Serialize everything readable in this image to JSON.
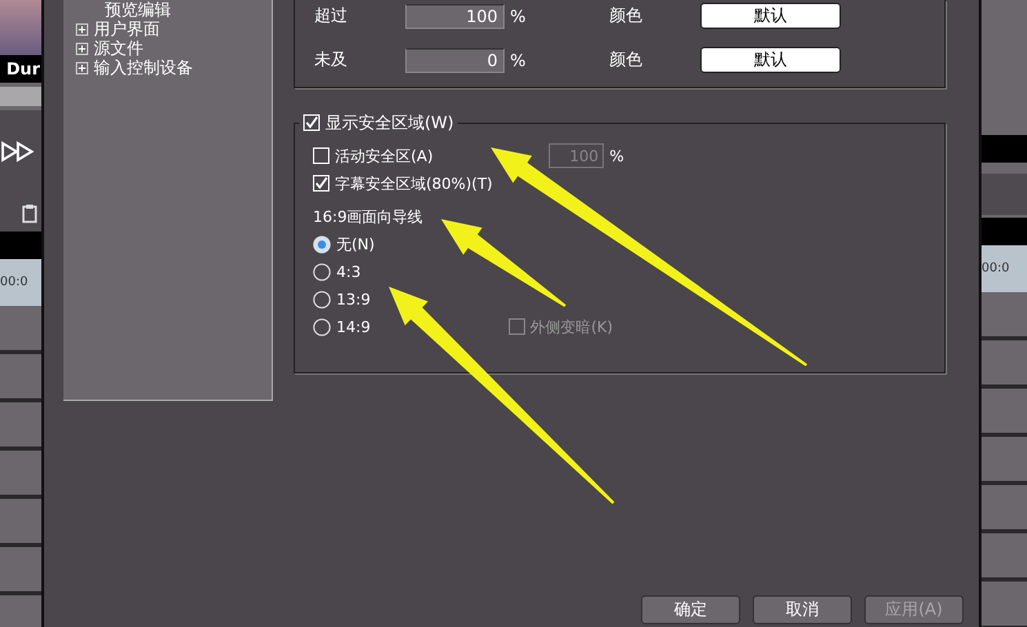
{
  "left_strip": {
    "clip_title": "Dur",
    "timecode": "00:0"
  },
  "tree": {
    "items": [
      {
        "label": "预览编辑",
        "kind": "leaf"
      },
      {
        "label": "用户界面",
        "kind": "folder",
        "expanded": false
      },
      {
        "label": "源文件",
        "kind": "folder",
        "expanded": false
      },
      {
        "label": "输入控制设备",
        "kind": "folder",
        "expanded": false
      }
    ]
  },
  "threshold_rows": [
    {
      "label": "超过",
      "value": "100",
      "unit": "%",
      "color_label": "颜色",
      "color_button": "默认"
    },
    {
      "label": "未及",
      "value": "0",
      "unit": "%",
      "color_label": "颜色",
      "color_button": "默认"
    }
  ],
  "safe_area": {
    "label": "显示安全区域(W)",
    "checked": true,
    "active_safe": {
      "label": "活动安全区(A)",
      "checked": false,
      "value": "100",
      "unit": "%",
      "disabled": true
    },
    "title_safe": {
      "label": "字幕安全区域(80%)(T)",
      "checked": true
    },
    "guide_label": "16:9画面向导线",
    "guides": [
      {
        "label": "无(N)",
        "selected": true
      },
      {
        "label": "4:3",
        "selected": false
      },
      {
        "label": "13:9",
        "selected": false
      },
      {
        "label": "14:9",
        "selected": false
      }
    ],
    "outer_dark": {
      "label": "外侧变暗(K)",
      "checked": false,
      "disabled": true
    }
  },
  "buttons": [
    {
      "label": "确定",
      "disabled": false
    },
    {
      "label": "取消",
      "disabled": false
    },
    {
      "label": "应用(A)",
      "disabled": true
    }
  ],
  "right_strip": {
    "timecode": "00:0"
  }
}
